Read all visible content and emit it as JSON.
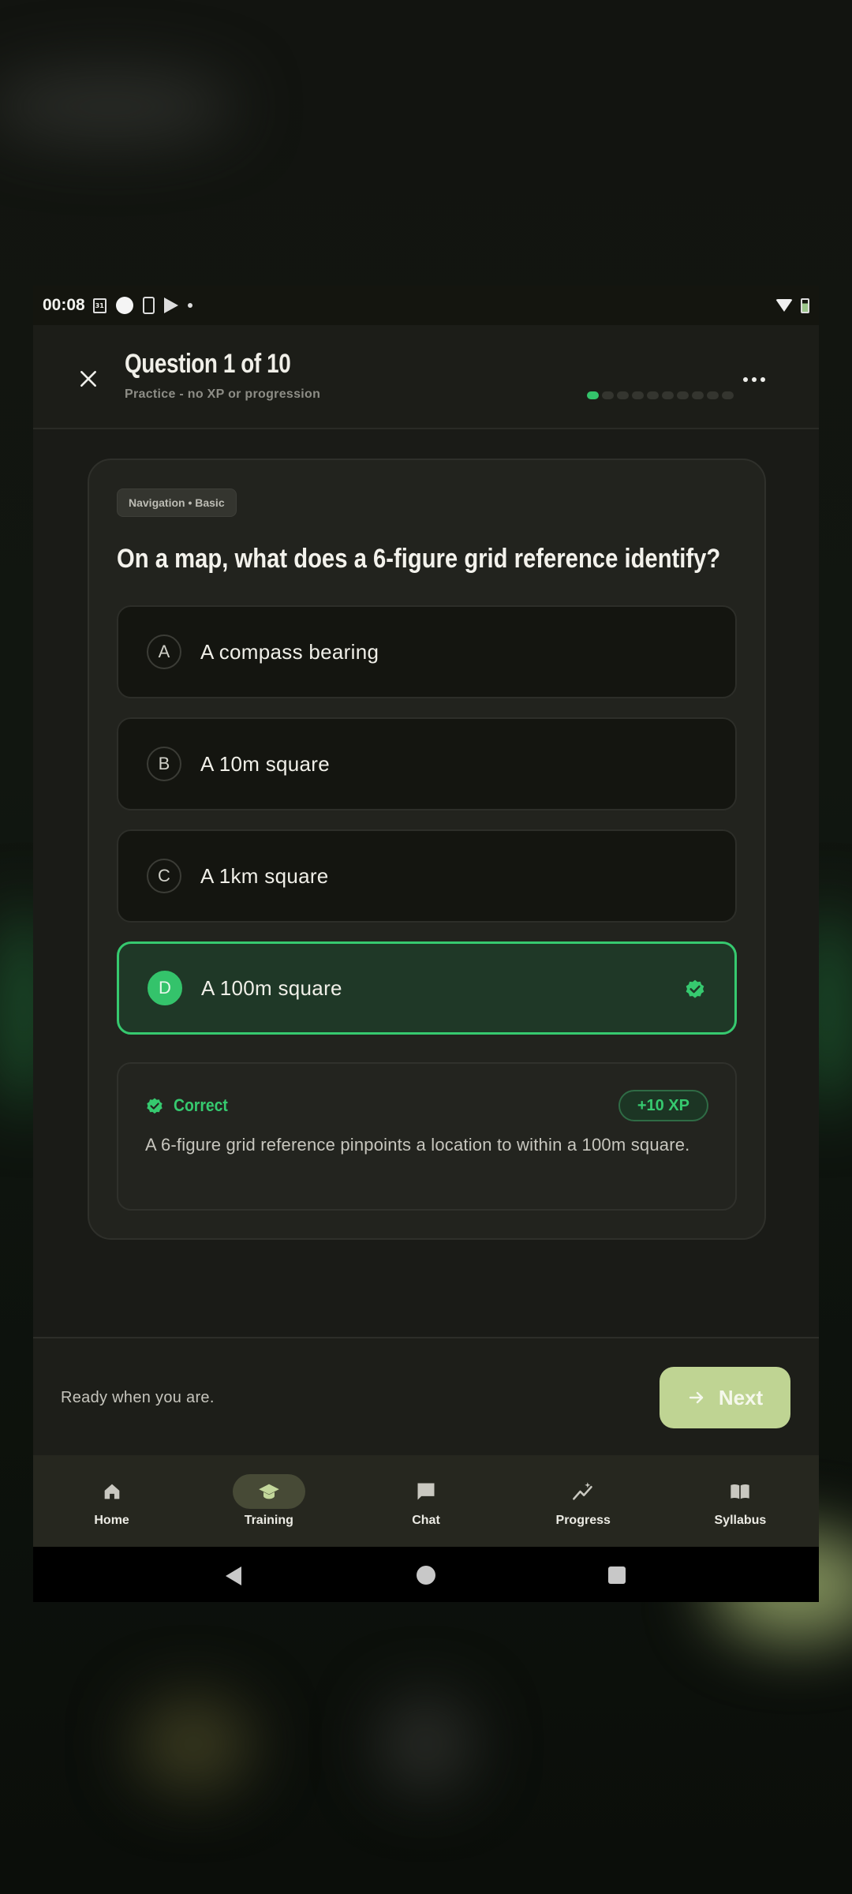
{
  "status_bar": {
    "time": "00:08",
    "calendar_day": "31"
  },
  "header": {
    "title": "Question 1 of 10",
    "subtitle": "Practice - no XP or progression",
    "progress": {
      "current": 1,
      "total": 10
    }
  },
  "question": {
    "tag": "Navigation • Basic",
    "text": "On a map, what does a 6-figure grid reference identify?",
    "options": [
      {
        "letter": "A",
        "text": "A compass bearing"
      },
      {
        "letter": "B",
        "text": "A 10m square"
      },
      {
        "letter": "C",
        "text": "A 1km square"
      },
      {
        "letter": "D",
        "text": "A 100m square",
        "state": "correct"
      }
    ]
  },
  "feedback": {
    "title": "Correct",
    "xp": "+10 XP",
    "text": "A 6-figure grid reference pinpoints a location to within a 100m square."
  },
  "footer": {
    "ready_text": "Ready when you are.",
    "next_label": "Next"
  },
  "nav": {
    "items": [
      {
        "label": "Home",
        "icon": "home-icon"
      },
      {
        "label": "Training",
        "icon": "graduation-cap-icon",
        "active": true
      },
      {
        "label": "Chat",
        "icon": "chat-icon"
      },
      {
        "label": "Progress",
        "icon": "progress-chart-icon"
      },
      {
        "label": "Syllabus",
        "icon": "book-icon"
      }
    ]
  },
  "colors": {
    "accent_green": "#34c36b",
    "next_button": "#bfd493",
    "background": "#1a1b17"
  }
}
